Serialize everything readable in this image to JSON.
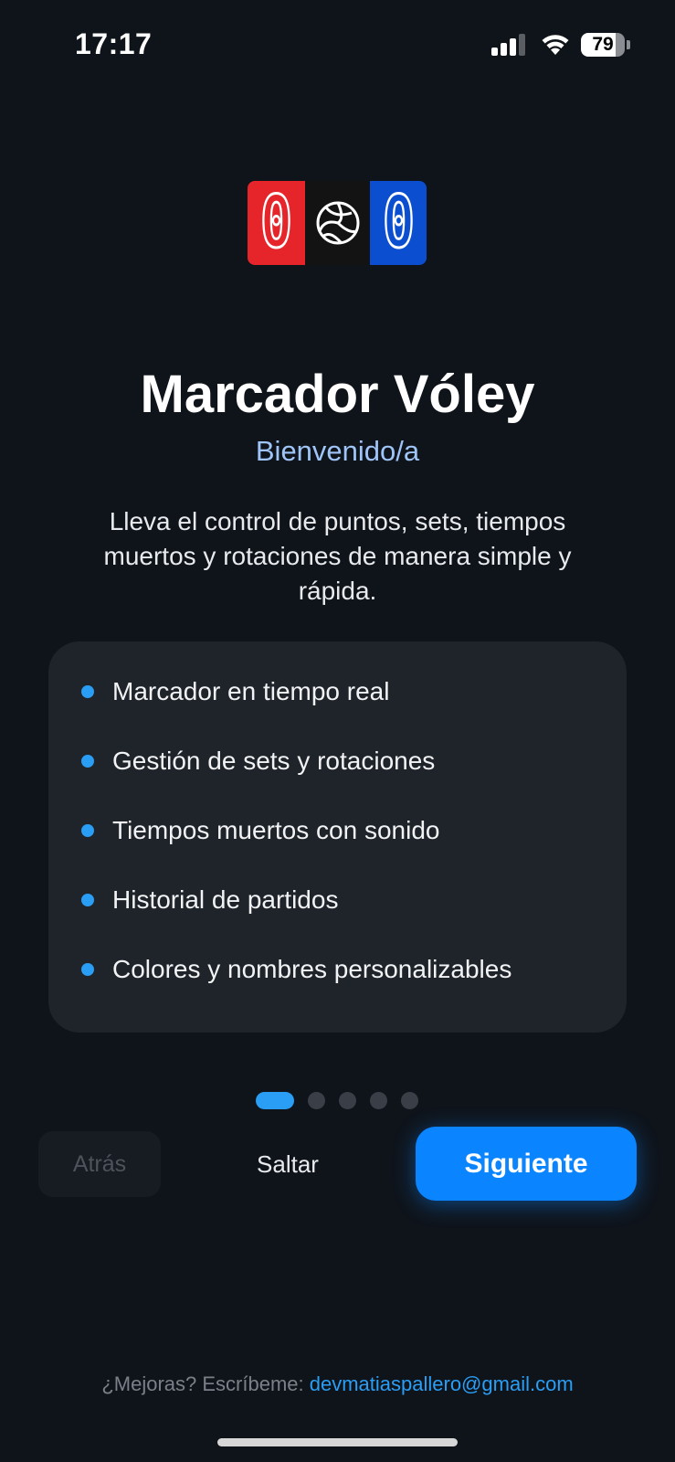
{
  "status_bar": {
    "time": "17:17",
    "battery_level": "79",
    "battery_fraction": 0.79,
    "signal_icon": "cellular-signal-icon",
    "wifi_icon": "wifi-icon",
    "battery_icon": "battery-icon"
  },
  "logo": {
    "home_score": "0",
    "away_score": "0",
    "center_icon": "volleyball-icon",
    "colors": {
      "home": "#e5252a",
      "center": "#131313",
      "away": "#0b4fd0"
    }
  },
  "onboarding": {
    "title": "Marcador Vóley",
    "subtitle": "Bienvenido/a",
    "description": "Lleva el control de puntos, sets, tiempos muertos y rotaciones de manera simple y rápida.",
    "features": [
      "Marcador en tiempo real",
      "Gestión de sets y rotaciones",
      "Tiempos muertos con sonido",
      "Historial de partidos",
      "Colores y nombres personalizables"
    ],
    "page_indicator": {
      "current": 1,
      "total": 5
    }
  },
  "buttons": {
    "back_label": "Atrás",
    "skip_label": "Saltar",
    "next_label": "Siguiente"
  },
  "footer": {
    "prompt": "¿Mejoras? Escríbeme: ",
    "email": "devmatiaspallero@gmail.com"
  },
  "colors": {
    "background": "#0f141b",
    "accent": "#0a84ff",
    "bullet": "#2a9df4",
    "card": "#1f232a",
    "subtitle": "#9fc5f8"
  }
}
